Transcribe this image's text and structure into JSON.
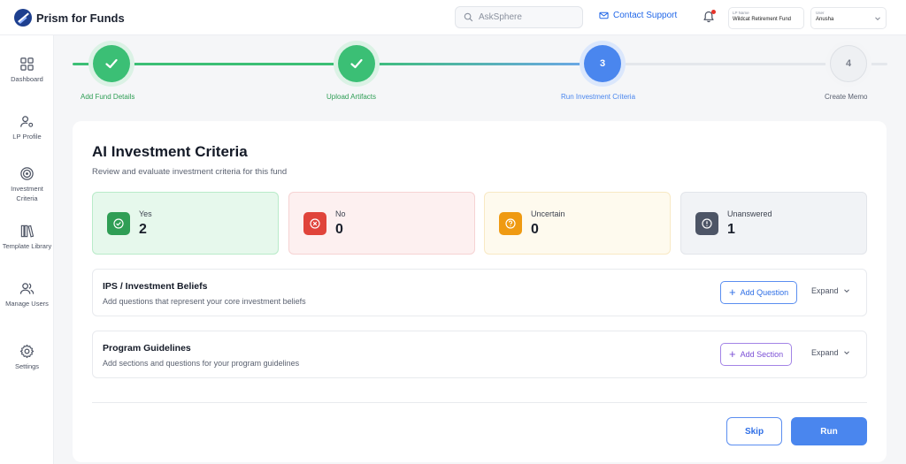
{
  "app": {
    "name": "Prism for Funds",
    "logo_icon": "prism-logo-icon"
  },
  "header": {
    "search_placeholder": "AskSphere",
    "contact_label": "Contact Support",
    "fund": {
      "label": "LP Name",
      "value": "Wildcat Retirement Fund"
    },
    "user": {
      "label": "User",
      "value": "Anusha"
    }
  },
  "sidebar": {
    "items": [
      {
        "label": "Dashboard",
        "icon": "dashboard-icon"
      },
      {
        "label": "LP Profile",
        "icon": "lp-profile-icon"
      },
      {
        "label": "Investment Criteria",
        "icon": "target-icon"
      },
      {
        "label": "Template Library",
        "icon": "library-icon"
      },
      {
        "label": "Manage Users",
        "icon": "users-icon"
      },
      {
        "label": "Settings",
        "icon": "gear-icon"
      }
    ]
  },
  "stepper": {
    "steps": [
      {
        "label": "Add Fund Details",
        "number": "1",
        "status": "complete"
      },
      {
        "label": "Upload Artifacts",
        "number": "2",
        "status": "complete"
      },
      {
        "label": "Run Investment Criteria",
        "number": "3",
        "status": "active"
      },
      {
        "label": "Create Memo",
        "number": "4",
        "status": "pending"
      }
    ]
  },
  "main": {
    "title": "AI Investment Criteria",
    "subtitle": "Review and evaluate investment criteria for this fund",
    "stats": [
      {
        "label": "Yes",
        "value": "2",
        "icon": "check-circle-icon",
        "color": "#2f9e55",
        "bg": "#e6f8ec",
        "border": "#b9ebc9"
      },
      {
        "label": "No",
        "value": "0",
        "icon": "x-circle-icon",
        "color": "#e0443b",
        "bg": "#fdf0f0",
        "border": "#f6d3d3"
      },
      {
        "label": "Uncertain",
        "value": "0",
        "icon": "question-circle-icon",
        "color": "#ef9a12",
        "bg": "#fefaee",
        "border": "#f8e9c4"
      },
      {
        "label": "Unanswered",
        "value": "1",
        "icon": "alert-circle-icon",
        "color": "#4d5566",
        "bg": "#f1f3f6",
        "border": "#e2e5ea"
      }
    ],
    "sections": [
      {
        "title": "IPS / Investment Beliefs",
        "description": "Add questions that represent your core investment beliefs",
        "add_label": "Add Question",
        "expand_label": "Expand"
      },
      {
        "title": "Program Guidelines",
        "description": "Add sections and questions for your program guidelines",
        "add_label": "Add Section",
        "expand_label": "Expand"
      }
    ],
    "skip_label": "Skip",
    "run_label": "Run"
  },
  "colors": {
    "accent": "#4a86ee",
    "success": "#3bbf75",
    "purple": "#7b4fd6"
  }
}
